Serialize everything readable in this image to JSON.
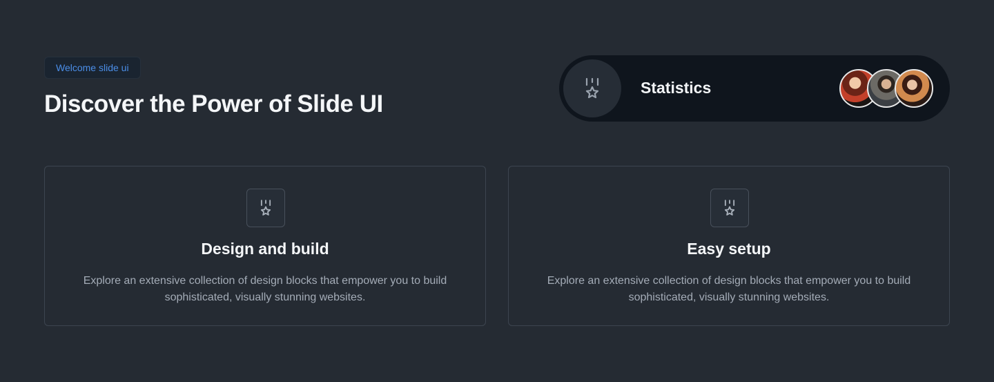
{
  "badge": {
    "label": "Welcome slide ui"
  },
  "hero": {
    "title": "Discover the Power of Slide UI"
  },
  "stats": {
    "label": "Statistics",
    "icon": "medal-star-icon",
    "avatars": [
      "avatar-1",
      "avatar-2",
      "avatar-3"
    ]
  },
  "features": [
    {
      "icon": "medal-star-icon",
      "title": "Design and build",
      "description": "Explore an extensive collection of design blocks that empower you to build sophisticated, visually stunning websites."
    },
    {
      "icon": "medal-star-icon",
      "title": "Easy setup",
      "description": "Explore an extensive collection of design blocks that empower you to build sophisticated, visually stunning websites."
    }
  ],
  "colors": {
    "background": "#252b33",
    "pill": "#0f151d",
    "accent": "#4b8ee8",
    "border": "#3d4550"
  }
}
